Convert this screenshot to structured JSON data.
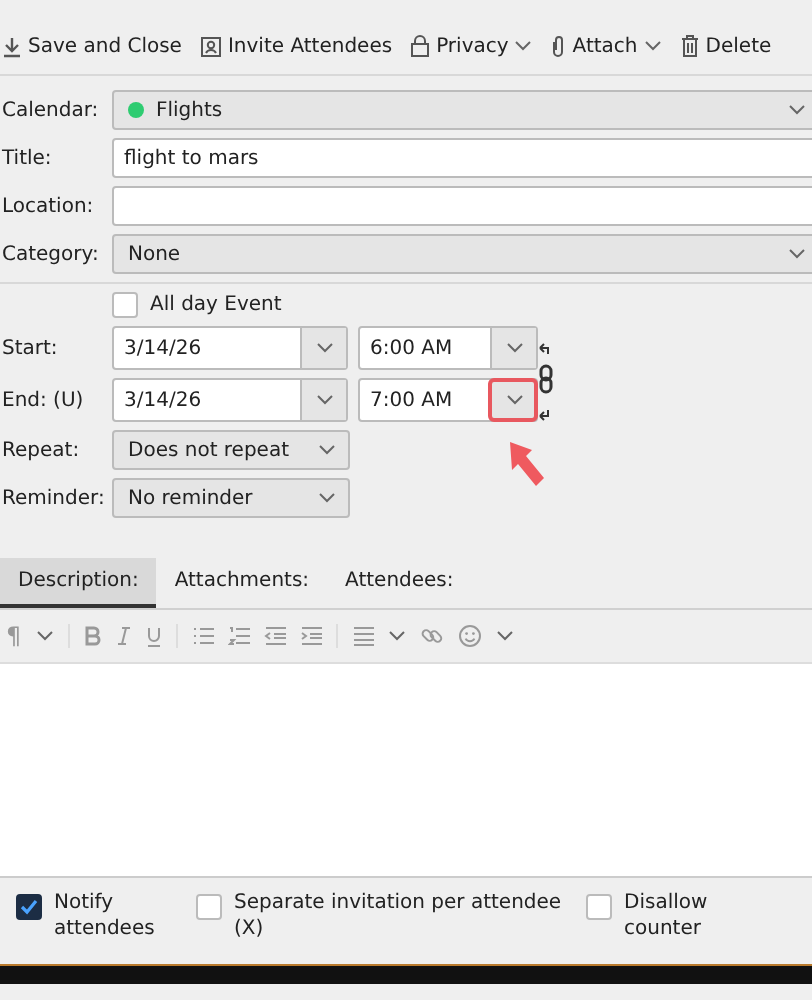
{
  "toolbar": [
    {
      "label": "Save and Close",
      "dropdown": false
    },
    {
      "label": "Invite Attendees",
      "dropdown": false
    },
    {
      "label": "Privacy",
      "dropdown": true
    },
    {
      "label": "Attach",
      "dropdown": true
    },
    {
      "label": "Delete",
      "dropdown": false
    }
  ],
  "calendar": {
    "label": "Calendar:",
    "value": "Flights",
    "color": "#2ecc71"
  },
  "title": {
    "label": "Title:",
    "value": "flight to mars"
  },
  "location": {
    "label": "Location:"
  },
  "category": {
    "label": "Category:",
    "value": "None"
  },
  "all_day": {
    "label": "All day Event",
    "checked": false
  },
  "start": {
    "label": "Start:",
    "date": "3/14/26",
    "time": "6:00 AM",
    "highlighted": false
  },
  "end": {
    "label": "End: (U)",
    "date": "3/14/26",
    "time": "7:00 AM",
    "highlighted": true
  },
  "repeat": {
    "label": "Repeat:",
    "value": "Does not repeat"
  },
  "reminder": {
    "label": "Reminder:",
    "value": "No reminder"
  },
  "tabs": [
    {
      "label": "Description:",
      "selected": true
    },
    {
      "label": "Attachments:",
      "selected": false
    },
    {
      "label": "Attendees:",
      "selected": false
    }
  ],
  "format_toolbar": {
    "paragraph": "¶"
  },
  "options": [
    {
      "label": "Notify attendees",
      "checked": true
    },
    {
      "label": "Separate invitation per attendee (X)",
      "checked": false
    },
    {
      "label": "Disallow counter",
      "checked": false
    }
  ]
}
